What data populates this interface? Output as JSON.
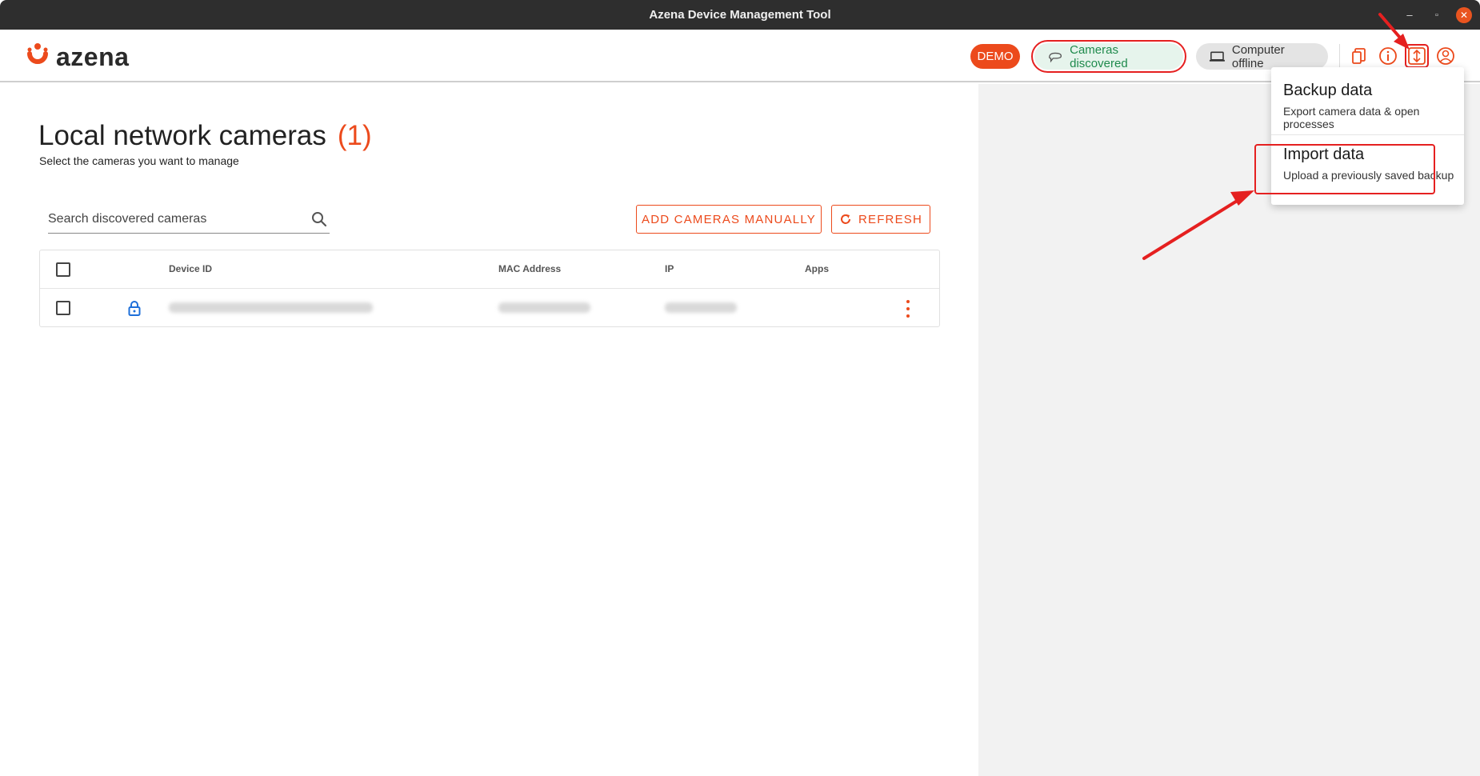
{
  "window": {
    "title": "Azena Device Management Tool",
    "minimize": "–",
    "maximize": "▫",
    "close": "✕"
  },
  "header": {
    "logo_text": "azena",
    "demo_badge": "DEMO",
    "status_cameras": "Cameras discovered",
    "status_computer": "Computer offline",
    "icons": [
      "devices-icon",
      "info-icon",
      "backup-icon",
      "account-icon"
    ]
  },
  "menu": {
    "backup_title": "Backup data",
    "backup_sub": "Export camera data & open processes",
    "import_title": "Import data",
    "import_sub": "Upload a previously saved backup"
  },
  "main": {
    "title": "Local network cameras",
    "count": "(1)",
    "subtitle": "Select the cameras you want to manage",
    "search_placeholder": "Search discovered cameras",
    "add_button": "ADD CAMERAS MANUALLY",
    "refresh_button": "REFRESH"
  },
  "table": {
    "columns": [
      "Device ID",
      "MAC Address",
      "IP",
      "Apps"
    ]
  },
  "colors": {
    "brand": "#ec4a1c",
    "success": "#1f8a4c",
    "annotation": "#e52020",
    "lock": "#1e6fd9"
  }
}
